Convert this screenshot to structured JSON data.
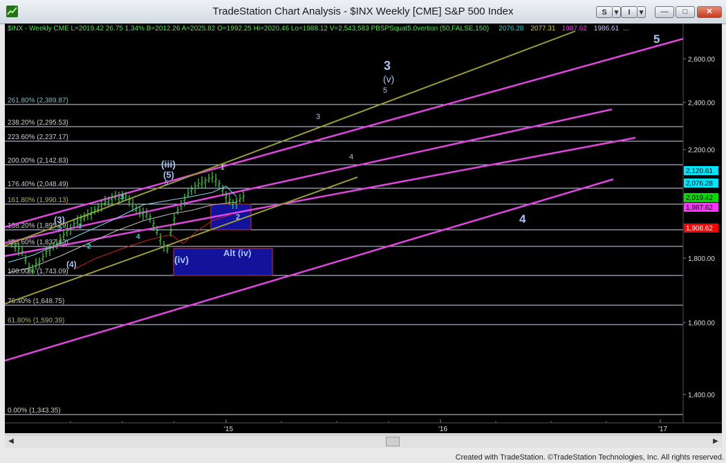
{
  "window": {
    "title": "TradeStation Chart Analysis - $INX Weekly [CME] S&P 500 Index",
    "toolbar": {
      "s_label": "S",
      "i_label": "I",
      "dropdown": "▾"
    },
    "controls": {
      "minimize": "—",
      "maximize": "□",
      "close": "✕"
    },
    "footer_credit": "Created with TradeStation. ©TradeStation Technologies, Inc. All rights reserved."
  },
  "header": {
    "parts": [
      {
        "text": "$INX - Weekly  CME  L=2019.42  26.75  1.34%  B=2012.26  A=2025.82  O=1992.25  Hi=2020.46  Lo=1988.12  V=2,543,583  PBSPSquat5.0vertion (50,FALSE,150)",
        "color": "#49e849"
      },
      {
        "text": "2076.28",
        "color": "#00d9e6"
      },
      {
        "text": "2077.31",
        "color": "#d4d400"
      },
      {
        "text": "1987.62",
        "color": "#ff33ff"
      },
      {
        "text": "1986.61",
        "color": "#c8c8ff"
      },
      {
        "text": "...",
        "color": "#cfcfcf"
      }
    ]
  },
  "price_scale": {
    "labels": [
      "2,600.00",
      "2,400.00",
      "2,200.00",
      "2,000.00",
      "1,800.00",
      "1,600.00",
      "1,400.00"
    ],
    "badges": [
      {
        "value": "2,120.61",
        "bg": "#00e5ff",
        "fg": "#000000"
      },
      {
        "value": "2,076.28",
        "bg": "#00e5ff",
        "fg": "#000000"
      },
      {
        "value": "2,019.42",
        "bg": "#00dd00",
        "fg": "#000000"
      },
      {
        "value": "1,987.62",
        "bg": "#ff33ff",
        "fg": "#000000"
      },
      {
        "value": "1,908.62",
        "bg": "#ff0000",
        "fg": "#ffffff"
      }
    ]
  },
  "time_axis": {
    "labels": [
      "'15",
      "'16",
      "'17"
    ]
  },
  "fib_levels": [
    {
      "label": "261.80% (2,389.87)",
      "color": "#7fbfbf"
    },
    {
      "label": "238.20% (2,295.53)",
      "color": "#cfcfcf"
    },
    {
      "label": "223.60% (2,237.17)",
      "color": "#cfcfcf"
    },
    {
      "label": "200.00% (2,142.83)",
      "color": "#cfcfcf"
    },
    {
      "label": "176.40% (2,048.49)",
      "color": "#cfcfcf"
    },
    {
      "label": "161.80% (1,990.13)",
      "color": "#b3b366"
    },
    {
      "label": "138.20% (1,895.79)",
      "color": "#cfcfcf"
    },
    {
      "label": "123.60% (1,837.43)",
      "color": "#cfcfcf"
    },
    {
      "label": "100.00% (1,743.09)",
      "color": "#cfcfcf"
    },
    {
      "label": "76.40% (1,648.75)",
      "color": "#cfcfcf"
    },
    {
      "label": "61.80% (1,590.39)",
      "color": "#b3b366"
    },
    {
      "label": "0.00% (1,343.35)",
      "color": "#cfcfcf"
    }
  ],
  "wave_labels": [
    {
      "text": "3",
      "color": "#a8c4f0"
    },
    {
      "text": "(v)",
      "color": "#a8c4f0"
    },
    {
      "text": "5",
      "color": "#a8c4f0"
    },
    {
      "text": "5",
      "color": "#a8c4f0"
    },
    {
      "text": "3",
      "color": "#a8c4f0"
    },
    {
      "text": "4",
      "color": "#a8c4f0"
    },
    {
      "text": "4",
      "color": "#a8c4f0"
    },
    {
      "text": "(iii)",
      "color": "#a8c4f0"
    },
    {
      "text": "(5)",
      "color": "#a8c4f0"
    },
    {
      "text": "5",
      "color": "#a8c4f0"
    },
    {
      "text": "1",
      "color": "#cfcfcf"
    },
    {
      "text": "2",
      "color": "#a8c4f0"
    },
    {
      "text": "(iv)",
      "color": "#a8c4f0"
    },
    {
      "text": "Alt (iv)",
      "color": "#a8c4f0"
    },
    {
      "text": "(3)",
      "color": "#a8c4f0"
    },
    {
      "text": "(4)",
      "color": "#a8c4f0"
    },
    {
      "text": "3",
      "color": "#4fd1d1"
    },
    {
      "text": "4",
      "color": "#4fd1d1"
    },
    {
      "text": "1",
      "color": "#4fd1d1"
    },
    {
      "text": "2",
      "color": "#4fd1d1"
    },
    {
      "text": "5",
      "color": "#4fd1d1"
    }
  ],
  "colors": {
    "chart_bg": "#000000",
    "channel_magenta": "#e046e0",
    "channel_olive": "#9c9c38",
    "fib_line": "#cfd6f0",
    "box_fill": "#12129a",
    "box_border": "#cc3333",
    "price_bars": "#4ecf4e"
  }
}
